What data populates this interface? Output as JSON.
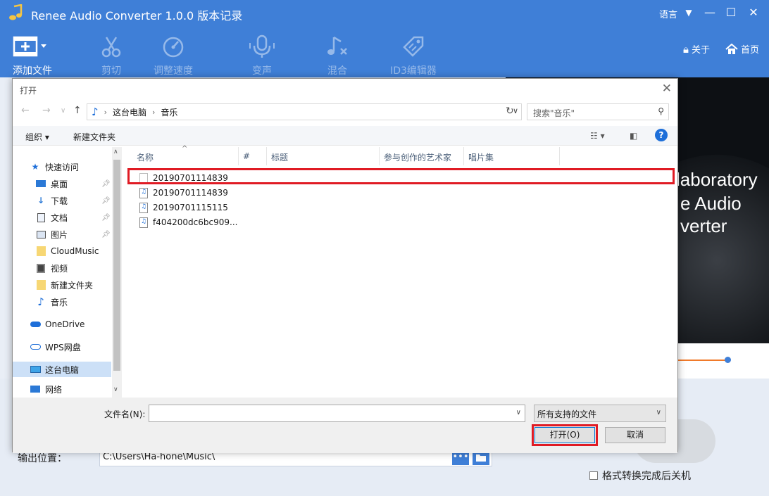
{
  "app": {
    "title": "Renee Audio Converter 1.0.0 版本记录",
    "language": "语言",
    "toolbar": [
      {
        "label": "添加文件",
        "icon": "add-file-icon",
        "enabled": true
      },
      {
        "label": "剪切",
        "icon": "scissors-icon",
        "enabled": false
      },
      {
        "label": "调整速度",
        "icon": "speed-gauge-icon",
        "enabled": false
      },
      {
        "label": "变声",
        "icon": "microphone-icon",
        "enabled": false
      },
      {
        "label": "混合",
        "icon": "music-mix-icon",
        "enabled": false
      },
      {
        "label": "ID3编辑器",
        "icon": "tag-icon",
        "enabled": false
      }
    ],
    "about": "关于",
    "home": "首页",
    "banner_lines": [
      "laboratory",
      "e Audio",
      "verter"
    ],
    "output_label": "输出位置：",
    "output_path": "C:\\Users\\Ha-hone\\Music\\",
    "shutdown_label": "格式转换完成后关机",
    "colors": {
      "primary": "#3f7fd7",
      "accent_orange": "#f07a2a",
      "highlight_red": "#e01b24"
    }
  },
  "dialog": {
    "title": "打开",
    "breadcrumb": [
      "这台电脑",
      "音乐"
    ],
    "search_placeholder": "搜索\"音乐\"",
    "organize": "组织 ▾",
    "new_folder": "新建文件夹",
    "nav": [
      {
        "label": "快速访问",
        "icon": "star-icon"
      },
      {
        "label": "桌面",
        "icon": "desktop-icon",
        "pinned": true
      },
      {
        "label": "下载",
        "icon": "download-icon",
        "pinned": true
      },
      {
        "label": "文档",
        "icon": "document-icon",
        "pinned": true
      },
      {
        "label": "图片",
        "icon": "picture-icon",
        "pinned": true
      },
      {
        "label": "CloudMusic",
        "icon": "folder-icon"
      },
      {
        "label": "视频",
        "icon": "video-icon"
      },
      {
        "label": "新建文件夹",
        "icon": "folder-icon"
      },
      {
        "label": "音乐",
        "icon": "music-icon"
      },
      {
        "label": "OneDrive",
        "icon": "cloud-icon"
      },
      {
        "label": "WPS网盘",
        "icon": "cloud-outline-icon"
      },
      {
        "label": "这台电脑",
        "icon": "computer-icon",
        "selected": true
      },
      {
        "label": "网络",
        "icon": "network-icon"
      }
    ],
    "columns": [
      "名称",
      "#",
      "标题",
      "参与创作的艺术家",
      "唱片集"
    ],
    "files": [
      {
        "name": "20190701114839",
        "type": "blank"
      },
      {
        "name": "20190701114839",
        "type": "audio"
      },
      {
        "name": "20190701115115",
        "type": "audio"
      },
      {
        "name": "f404200dc6bc909...",
        "type": "audio"
      }
    ],
    "filename_label": "文件名(N):",
    "filename_value": "",
    "filetype": "所有支持的文件",
    "open_button": "打开(O)",
    "cancel_button": "取消"
  }
}
